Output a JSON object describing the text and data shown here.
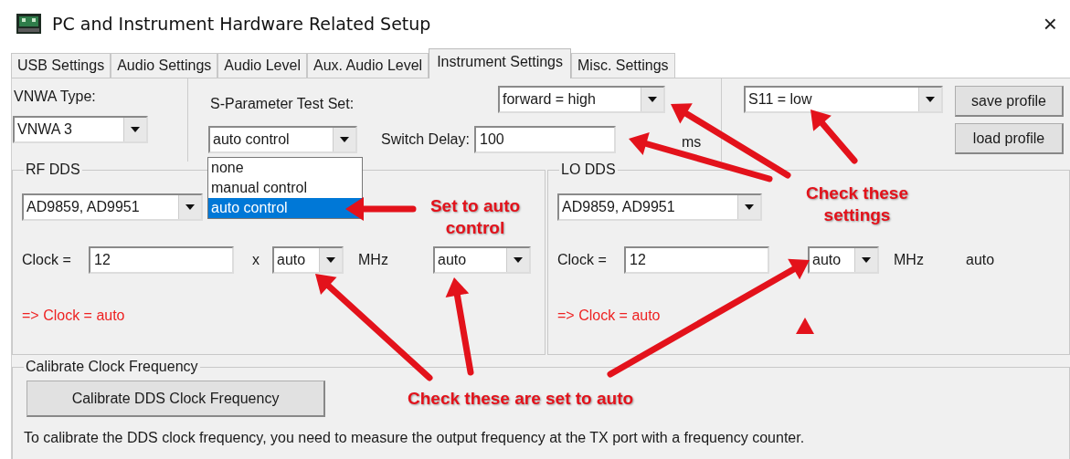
{
  "window": {
    "title": "PC and Instrument Hardware Related Setup",
    "close": "×"
  },
  "tabs": [
    {
      "label": "USB Settings",
      "selected": false
    },
    {
      "label": "Audio Settings",
      "selected": false
    },
    {
      "label": "Audio Level",
      "selected": false
    },
    {
      "label": "Aux. Audio Level",
      "selected": false
    },
    {
      "label": "Instrument Settings",
      "selected": true
    },
    {
      "label": "Misc. Settings",
      "selected": false
    }
  ],
  "vnwa_type": {
    "label": "VNWA Type:",
    "value": "VNWA 3"
  },
  "s_parameter_test_set": {
    "label": "S-Parameter Test Set:",
    "value": "auto control",
    "direction": "forward = high",
    "dropdown": {
      "expanded": true,
      "options": [
        {
          "label": "none",
          "selected": false
        },
        {
          "label": "manual control",
          "selected": false
        },
        {
          "label": "auto control",
          "selected": true
        }
      ]
    }
  },
  "switch_delay": {
    "label": "Switch Delay:",
    "value": "100",
    "unit": "ms"
  },
  "port_mode": {
    "value": "S11 = low"
  },
  "buttons": [
    "save profile",
    "load profile"
  ],
  "rf_dds": {
    "title": "RF DDS",
    "chip": "AD9859, AD9951",
    "clock_label": "Clock =",
    "clock": "12",
    "times": "x",
    "multiplier": "auto",
    "unit": "MHz",
    "column_5": {
      "kind": "combo",
      "value": "auto"
    },
    "result": "=> Clock = auto"
  },
  "lo_dds": {
    "title": "LO DDS",
    "chip": "AD9859, AD9951",
    "clock_label": "Clock =",
    "clock": "12",
    "multiplier": "auto",
    "unit": "MHz",
    "column_5": {
      "kind": "text",
      "value": "auto"
    },
    "result": "=> Clock = auto"
  },
  "calibrate": {
    "title": "Calibrate Clock Frequency",
    "button": "Calibrate DDS Clock Frequency",
    "note": "To calibrate the DDS clock frequency, you need to measure the output frequency at the TX port with a frequency counter."
  },
  "annotations": [
    {
      "text": "Set to auto control"
    },
    {
      "text": "Check these settings"
    },
    {
      "text": "Check these are set to auto"
    }
  ]
}
